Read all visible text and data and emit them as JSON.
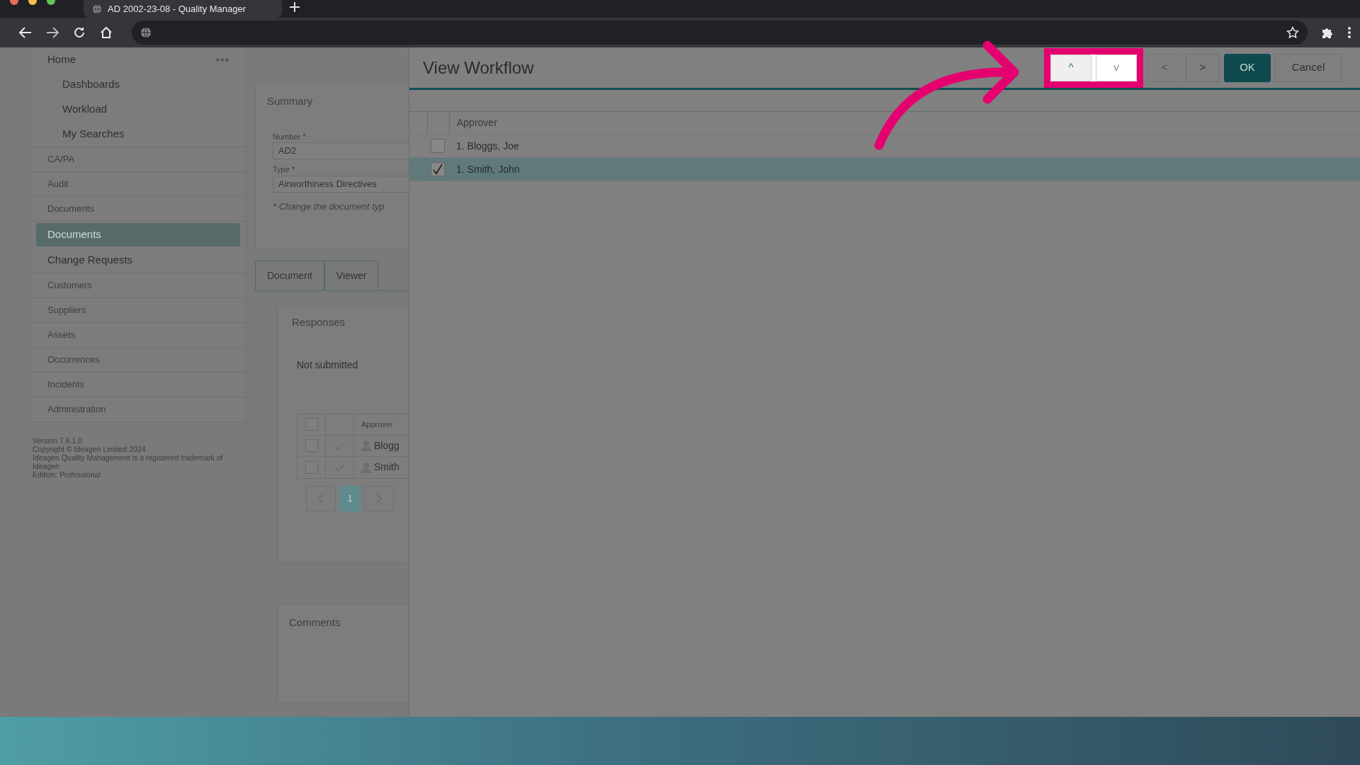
{
  "browser": {
    "tab_title": "AD 2002-23-08 - Quality Manager"
  },
  "sidebar": {
    "items": [
      {
        "label": "Home",
        "kind": "section",
        "children": [
          {
            "label": "Dashboards",
            "selected": false
          },
          {
            "label": "Workload",
            "selected": false
          },
          {
            "label": "My Searches",
            "selected": false
          }
        ]
      },
      {
        "label": "CA/PA",
        "kind": "module"
      },
      {
        "label": "Audit",
        "kind": "module"
      },
      {
        "label": "Documents",
        "kind": "module"
      },
      {
        "label": "Documents",
        "kind": "link",
        "selected": true
      },
      {
        "label": "Change Requests",
        "kind": "link",
        "selected": false
      },
      {
        "label": "Customers",
        "kind": "module"
      },
      {
        "label": "Suppliers",
        "kind": "module"
      },
      {
        "label": "Assets",
        "kind": "module"
      },
      {
        "label": "Occurrences",
        "kind": "module"
      },
      {
        "label": "Incidents",
        "kind": "module"
      },
      {
        "label": "Administration",
        "kind": "module"
      }
    ],
    "footer": [
      "Version 7.6.1.0",
      "Copyright © Ideagen Limited 2024",
      "Ideagen Quality Management is a registered trademark of Ideagen",
      "Edition: Professional"
    ]
  },
  "summary": {
    "title": "Summary",
    "fields": [
      {
        "label": "Number",
        "mark": "*",
        "value": "AD2"
      },
      {
        "label": "Type",
        "mark": "*",
        "value": "Airworthiness Directives"
      }
    ],
    "note": "* Change the document typ"
  },
  "tabs": [
    {
      "label": "Document"
    },
    {
      "label": "Viewer"
    }
  ],
  "responses": {
    "title": "Responses",
    "status": "Not submitted",
    "select_all": {
      "checked": false
    },
    "columns": [
      "Approver"
    ],
    "rows": [
      {
        "name": "Blogg",
        "checked": false
      },
      {
        "name": "Smith",
        "checked": false
      }
    ],
    "pages": [
      {
        "label": "1",
        "selected": true
      }
    ]
  },
  "comments": {
    "title": "Comments"
  },
  "dialog": {
    "title": "View Workflow",
    "buttons": [
      {
        "label": "^",
        "kind": "move",
        "disabled": false
      },
      {
        "label": "v",
        "kind": "move",
        "disabled": true
      },
      {
        "label": "<",
        "kind": "nav",
        "disabled": true
      },
      {
        "label": ">",
        "kind": "nav",
        "disabled": false
      },
      {
        "label": "OK",
        "kind": "primary"
      },
      {
        "label": "Cancel",
        "kind": "secondary"
      }
    ],
    "table": {
      "columns": [
        "Approver"
      ],
      "rows": [
        {
          "label": "1. Bloggs, Joe",
          "checked": false,
          "selected": false
        },
        {
          "label": "1. Smith, John",
          "checked": true,
          "selected": true
        }
      ]
    }
  }
}
